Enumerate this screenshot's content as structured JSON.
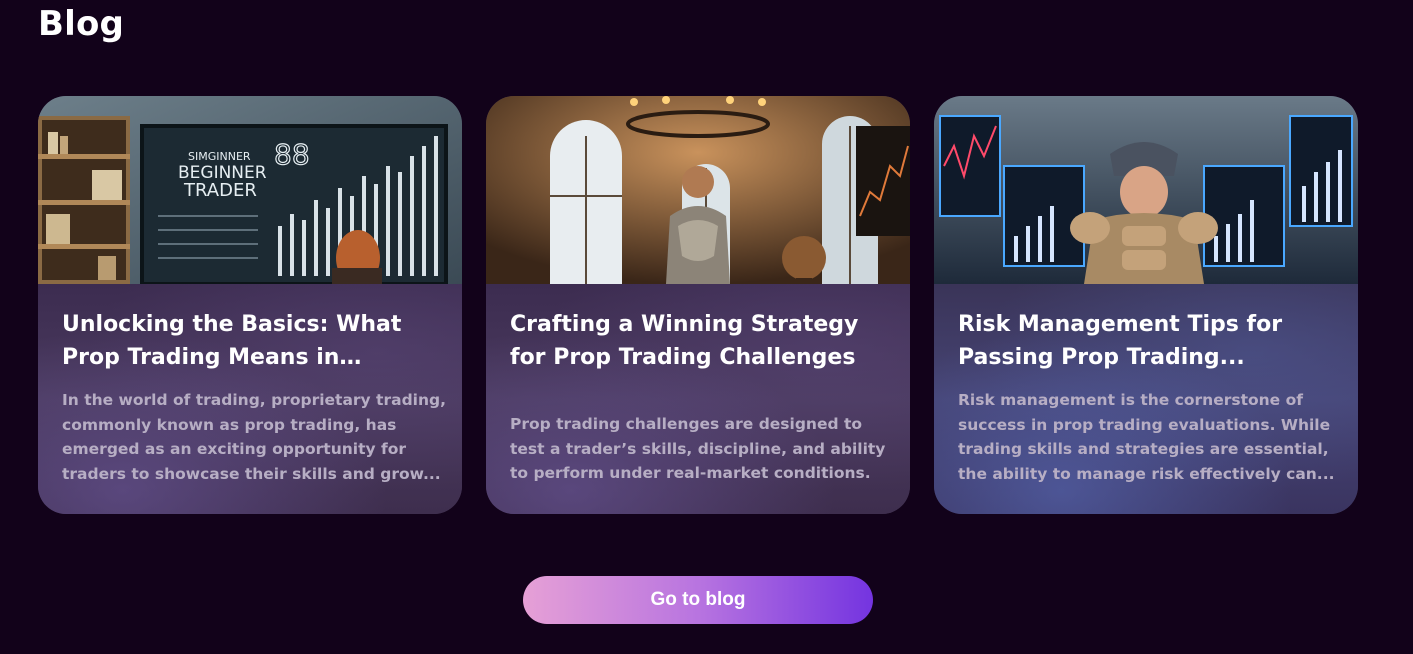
{
  "section": {
    "title": "Blog"
  },
  "posts": [
    {
      "title": "Unlocking the Basics: What Prop Trading Means in Today’s...",
      "excerpt": "In the world of trading, proprietary trading, commonly known as prop trading, has emerged as an exciting opportunity for traders to showcase their skills and grow...",
      "image": {
        "alt": "beginner-trader-illustration",
        "poster_lines": [
          "SIMGINNER",
          "BEGINNER",
          "TRADER"
        ],
        "poster_number": "88"
      }
    },
    {
      "title": "Crafting a Winning Strategy for Prop Trading Challenges",
      "excerpt": "Prop trading challenges are designed to test a trader’s skills, discipline, and ability to perform under real-market conditions.",
      "image": {
        "alt": "knight-in-trading-hall-illustration"
      }
    },
    {
      "title": "Risk Management Tips for Passing Prop Trading...",
      "excerpt": "Risk management is the cornerstone of success in prop trading evaluations. While trading skills and strategies are essential, the ability to manage risk effectively can...",
      "image": {
        "alt": "padded-trader-monitors-illustration"
      }
    }
  ],
  "cta": {
    "label": "Go to blog"
  },
  "colors": {
    "background": "#12021a",
    "cta_start": "#e6a0d6",
    "cta_end": "#7434e0",
    "excerpt": "#b7aec4"
  }
}
